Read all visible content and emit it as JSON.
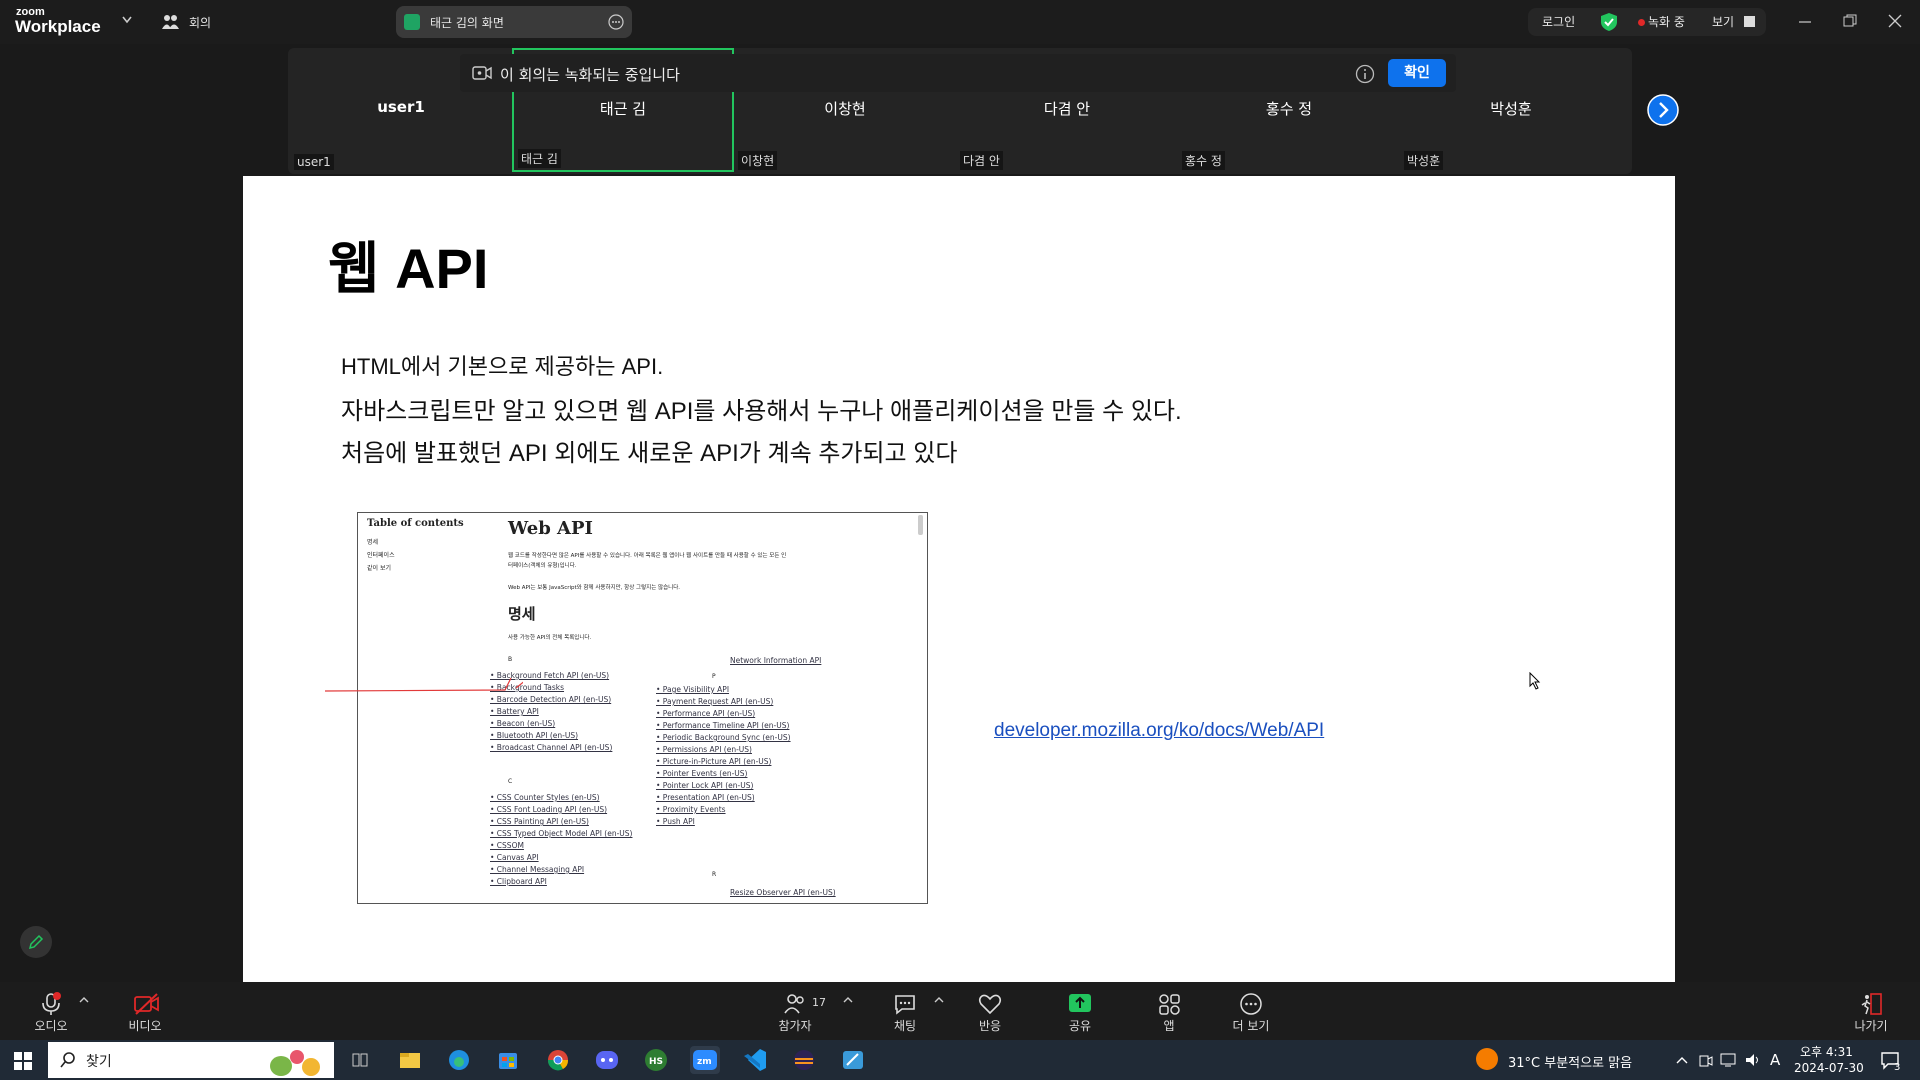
{
  "topbar": {
    "logo_small": "zoom",
    "logo_big": "Workplace",
    "meetings_label": "회의",
    "screen_title": "태근 김의 화면",
    "login_label": "로그인",
    "recording_label": "녹화 중",
    "view_label": "보기"
  },
  "notice": {
    "text": "이 회의는 녹화되는 중입니다",
    "confirm_label": "확인"
  },
  "participants": [
    {
      "name": "user1",
      "label": "user1"
    },
    {
      "name": "태근 김",
      "label": "태근 김"
    },
    {
      "name": "이창현",
      "label": "이창현"
    },
    {
      "name": "다겸 안",
      "label": "다겸 안"
    },
    {
      "name": "홍수 정",
      "label": "홍수 정"
    },
    {
      "name": "박성훈",
      "label": "박성훈"
    }
  ],
  "slide": {
    "title": "웹 API",
    "lines": [
      "HTML에서 기본으로 제공하는 API.",
      "자바스크립트만 알고 있으면 웹 API를 사용해서 누구나 애플리케이션을 만들 수 있다.",
      "처음에 발표했던 API 외에도 새로운 API가 계속 추가되고 있다"
    ],
    "link": "developer.mozilla.org/ko/docs/Web/API"
  },
  "mdn": {
    "toc_title": "Table of contents",
    "toc_items": [
      "명세",
      "인터페이스",
      "같이 보기"
    ],
    "page_title": "Web API",
    "intro1": "웹 코드를 작성한다면 많은 API를 사용할 수 있습니다. 아래 목록은 웹 앱이나 웹 사이트를 만들 때 사용할 수 있는 모든 인",
    "intro1b": "터페이스(객체의 유형)입니다.",
    "intro2": "Web API는 보통 JavaScript와 함께 사용하지만, 항상 그렇지는 않습니다.",
    "section": "명세",
    "section_desc": "사용 가능한 API의 전체 목록입니다.",
    "letter_b": "B",
    "letter_c": "C",
    "letter_p": "P",
    "letter_r": "R",
    "col1_b": [
      "Background Fetch API (en-US)",
      "Background Tasks",
      "Barcode Detection API (en-US)",
      "Battery API",
      "Beacon (en-US)",
      "Bluetooth API (en-US)",
      "Broadcast Channel API (en-US)"
    ],
    "col1_c": [
      "CSS Counter Styles (en-US)",
      "CSS Font Loading API (en-US)",
      "CSS Painting API (en-US)",
      "CSS Typed Object Model API (en-US)",
      "CSSOM",
      "Canvas API",
      "Channel Messaging API",
      "Clipboard API"
    ],
    "col2_top": "Network Information API",
    "col2_p": [
      "Page Visibility API",
      "Payment Request API (en-US)",
      "Performance API (en-US)",
      "Performance Timeline API (en-US)",
      "Periodic Background Sync (en-US)",
      "Permissions API (en-US)",
      "Picture-in-Picture API (en-US)",
      "Pointer Events (en-US)",
      "Pointer Lock API (en-US)",
      "Presentation API (en-US)",
      "Proximity Events",
      "Push API"
    ],
    "col2_r": "Resize Observer API (en-US)"
  },
  "toolbar": {
    "audio": "오디오",
    "video": "비디오",
    "participants": "참가자",
    "participants_count": "17",
    "chat": "채팅",
    "reactions": "반응",
    "share": "공유",
    "apps": "앱",
    "more": "더 보기",
    "leave": "나가기"
  },
  "taskbar": {
    "search": "찾기",
    "weather": "31°C  부분적으로 맑음",
    "time": "오후 4:31",
    "date": "2024-07-30",
    "ime": "A",
    "notif_count": "3"
  },
  "colors": {
    "accent_blue": "#0e72ed",
    "recording_red": "#e02828",
    "active_speaker": "#22c55e",
    "share_green": "#22c55e"
  }
}
